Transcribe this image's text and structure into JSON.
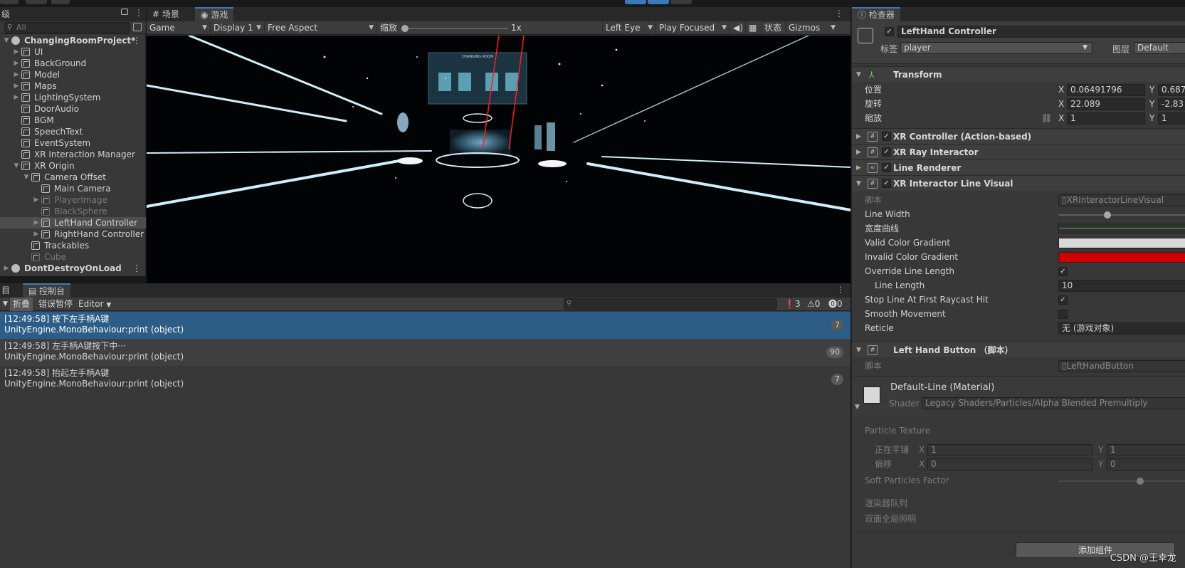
{
  "hierarchy": {
    "tab_label": "级",
    "search_placeholder": "All",
    "items": [
      {
        "label": "ChangingRoomProject*",
        "kind": "scene"
      },
      {
        "label": "UI"
      },
      {
        "label": "BackGround"
      },
      {
        "label": "Model"
      },
      {
        "label": "Maps"
      },
      {
        "label": "LightingSystem"
      },
      {
        "label": "DoorAudio"
      },
      {
        "label": "BGM"
      },
      {
        "label": "SpeechText"
      },
      {
        "label": "EventSystem"
      },
      {
        "label": "XR Interaction Manager"
      },
      {
        "label": "XR Origin"
      },
      {
        "label": "Camera Offset"
      },
      {
        "label": "Main Camera"
      },
      {
        "label": "PlayerImage"
      },
      {
        "label": "BlackSphere"
      },
      {
        "label": "LeftHand Controller"
      },
      {
        "label": "RightHand Controller"
      },
      {
        "label": "Trackables"
      },
      {
        "label": "Cube"
      },
      {
        "label": "DontDestroyOnLoad",
        "kind": "scene"
      }
    ]
  },
  "game": {
    "tab_scene": "场景",
    "tab_game": "游戏",
    "mode": "Game",
    "display": "Display 1",
    "aspect": "Free Aspect",
    "scale_label": "缩放",
    "scale_value": "1x",
    "eye": "Left Eye",
    "play_mode": "Play Focused",
    "stats": "状态",
    "gizmos": "Gizmos",
    "viewport_title": "CHANGING ROOM"
  },
  "console": {
    "tab_project": "目",
    "tab_console": "控制台",
    "collapse": "折叠",
    "error_pause": "错误暂停",
    "editor": "Editor",
    "count_log": "3",
    "count_warn": "0",
    "count_error": "0",
    "logs": [
      {
        "line1": "[12:49:58] 按下左手柄A键",
        "line2": "UnityEngine.MonoBehaviour:print (object)",
        "count": "7"
      },
      {
        "line1": "[12:49:58] 左手柄A键按下中···",
        "line2": "UnityEngine.MonoBehaviour:print (object)",
        "count": "90"
      },
      {
        "line1": "[12:49:58] 抬起左手柄A键",
        "line2": "UnityEngine.MonoBehaviour:print (object)",
        "count": "7"
      }
    ]
  },
  "inspector": {
    "tab_label": "检查器",
    "object_name": "LeftHand Controller",
    "tag_label": "标签",
    "tag_value": "player",
    "layer_label": "图层",
    "layer_value": "Default",
    "transform": {
      "title": "Transform",
      "position_label": "位置",
      "rotation_label": "旋转",
      "scale_label": "缩放",
      "pos_x": "0.06491796",
      "pos_y": "0.687",
      "rot_x": "22.089",
      "rot_y": "-2.83",
      "scale_x": "1",
      "scale_y": "1",
      "x": "X",
      "y": "Y"
    },
    "components": {
      "xr_controller": "XR Controller (Action-based)",
      "xr_ray": "XR Ray Interactor",
      "line_renderer": "Line Renderer",
      "line_visual": "XR Interactor Line Visual"
    },
    "line_visual": {
      "script_label": "脚本",
      "script_value": "XRInteractorLineVisual",
      "line_width_label": "Line Width",
      "width_curve_label": "宽度曲线",
      "valid_color_label": "Valid Color Gradient",
      "invalid_color_label": "Invalid Color Gradient",
      "override_label": "Override Line Length",
      "line_length_label": "Line Length",
      "line_length_value": "10",
      "stop_line_label": "Stop Line At First Raycast Hit",
      "smooth_label": "Smooth Movement",
      "reticle_label": "Reticle",
      "reticle_value": "无 (游戏对象)",
      "valid_color": "#d9d9d9",
      "invalid_color": "#d00000"
    },
    "left_hand_button": {
      "title": "Left Hand Button （脚本）",
      "script_label": "脚本",
      "script_value": "LeftHandButton"
    },
    "material": {
      "name": "Default-Line (Material)",
      "shader_label": "Shader",
      "shader_value": "Legacy Shaders/Particles/Alpha Blended Premultiply",
      "particle_texture": "Particle Texture",
      "tiling_label": "正在平铺",
      "offset_label": "偏移",
      "tiling_x": "1",
      "tiling_y": "1",
      "offset_x": "0",
      "offset_y": "0",
      "soft_particles": "Soft Particles Factor",
      "render_queue": "渲染器队列",
      "double_sided_gi": "双面全局照明"
    },
    "add_component": "添加组件"
  },
  "watermark": "CSDN @王幸龙"
}
